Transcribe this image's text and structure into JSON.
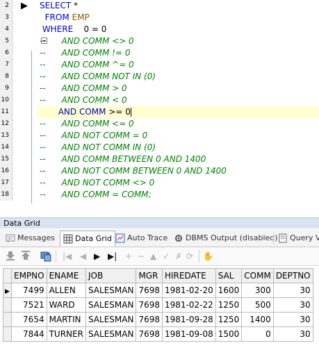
{
  "editor": {
    "lines": [
      {
        "num": "2",
        "segments": [
          {
            "t": "SELECT",
            "c": "kw"
          },
          {
            "t": " *",
            "c": "num"
          }
        ]
      },
      {
        "num": "3",
        "segments": [
          {
            "t": "  FROM",
            "c": "kw"
          },
          {
            "t": " EMP",
            "c": "tbl"
          }
        ]
      },
      {
        "num": "4",
        "segments": [
          {
            "t": " WHERE",
            "c": "kw"
          },
          {
            "t": "    0 = 0",
            "c": "num"
          }
        ]
      },
      {
        "num": "5",
        "segments": [
          {
            "t": "--      AND COMM <> 0",
            "c": "cm"
          }
        ]
      },
      {
        "num": "6",
        "segments": [
          {
            "t": "--      AND COMM != 0",
            "c": "cm"
          }
        ]
      },
      {
        "num": "7",
        "segments": [
          {
            "t": "--      AND COMM ^= 0",
            "c": "cm"
          }
        ]
      },
      {
        "num": "8",
        "segments": [
          {
            "t": "--      AND COMM NOT IN (0)",
            "c": "cm"
          }
        ]
      },
      {
        "num": "9",
        "segments": [
          {
            "t": "--      AND COMM > 0",
            "c": "cm"
          }
        ]
      },
      {
        "num": "10",
        "segments": [
          {
            "t": "--      AND COMM < 0",
            "c": "cm"
          }
        ]
      },
      {
        "num": "11",
        "segments": [
          {
            "t": "       AND",
            "c": "kw"
          },
          {
            "t": " COMM ",
            "c": "kw"
          },
          {
            "t": ">= 0",
            "c": "num"
          }
        ]
      },
      {
        "num": "12",
        "segments": [
          {
            "t": "--      AND COMM <= 0",
            "c": "cm"
          }
        ]
      },
      {
        "num": "13",
        "segments": [
          {
            "t": "--      AND NOT COMM = 0",
            "c": "cm"
          }
        ]
      },
      {
        "num": "14",
        "segments": [
          {
            "t": "--      AND NOT COMM IN (0)",
            "c": "cm"
          }
        ]
      },
      {
        "num": "15",
        "segments": [
          {
            "t": "--      AND COMM BETWEEN 0 AND 1400",
            "c": "cm"
          }
        ]
      },
      {
        "num": "16",
        "segments": [
          {
            "t": "--      AND NOT COMM BETWEEN 0 AND 1400",
            "c": "cm"
          }
        ]
      },
      {
        "num": "17",
        "segments": [
          {
            "t": "--      AND NOT COMM <> 0",
            "c": "cm"
          }
        ]
      },
      {
        "num": "18",
        "segments": [
          {
            "t": "--      AND COMM = COMM;",
            "c": "cm"
          }
        ]
      }
    ],
    "current_line_index": 9
  },
  "grid_panel": {
    "title": "Data Grid",
    "tabs": [
      {
        "label": "Messages",
        "icon": "messages-icon"
      },
      {
        "label": "Data Grid",
        "icon": "data-grid-icon"
      },
      {
        "label": "Auto Trace",
        "icon": "auto-trace-icon"
      },
      {
        "label": "DBMS Output (disabled)",
        "icon": "dbms-output-icon"
      },
      {
        "label": "Query Vi",
        "icon": "query-viewer-icon"
      }
    ],
    "active_tab": "Data Grid"
  },
  "colors": {
    "keyword": "#0000c8",
    "table": "#8c5a00",
    "comment": "#008000",
    "current_line": "#ffffd0"
  },
  "table": {
    "columns": [
      "EMPNO",
      "ENAME",
      "JOB",
      "MGR",
      "HIREDATE",
      "SAL",
      "COMM",
      "DEPTNO"
    ],
    "rows": [
      [
        "7499",
        "ALLEN",
        "SALESMAN",
        "7698",
        "1981-02-20",
        "1600",
        "300",
        "30"
      ],
      [
        "7521",
        "WARD",
        "SALESMAN",
        "7698",
        "1981-02-22",
        "1250",
        "500",
        "30"
      ],
      [
        "7654",
        "MARTIN",
        "SALESMAN",
        "7698",
        "1981-09-28",
        "1250",
        "1400",
        "30"
      ],
      [
        "7844",
        "TURNER",
        "SALESMAN",
        "7698",
        "1981-09-08",
        "1500",
        "0",
        "30"
      ]
    ]
  }
}
